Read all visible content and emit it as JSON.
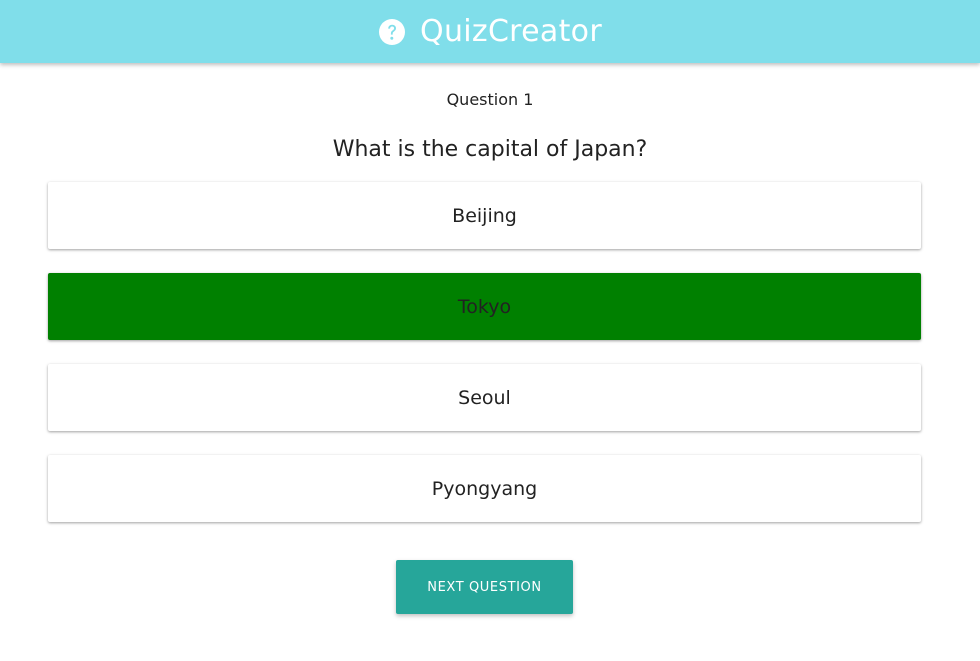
{
  "header": {
    "title": "QuizCreator",
    "icon": "help-circle-icon",
    "background_color": "#80deea"
  },
  "quiz": {
    "question_number": "Question 1",
    "question_text": "What is the capital of Japan?",
    "answers": [
      {
        "label": "Beijing",
        "selected_correct": false
      },
      {
        "label": "Tokyo",
        "selected_correct": true
      },
      {
        "label": "Seoul",
        "selected_correct": false
      },
      {
        "label": "Pyongyang",
        "selected_correct": false
      }
    ],
    "correct_color": "#008000",
    "next_button_label": "NEXT QUESTION",
    "next_button_color": "#26a69a"
  }
}
